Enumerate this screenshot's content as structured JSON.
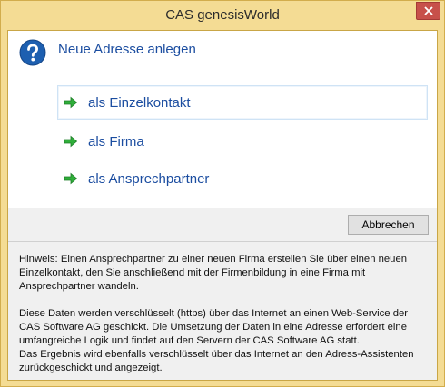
{
  "window": {
    "title": "CAS genesisWorld",
    "close_icon": "close-icon"
  },
  "dialog": {
    "heading": "Neue Adresse anlegen",
    "heading_icon": "question-icon",
    "options": [
      {
        "label": "als Einzelkontakt",
        "icon": "green-arrow-icon",
        "selected": true
      },
      {
        "label": "als Firma",
        "icon": "green-arrow-icon",
        "selected": false
      },
      {
        "label": "als Ansprechpartner",
        "icon": "green-arrow-icon",
        "selected": false
      }
    ],
    "cancel_label": "Abbrechen"
  },
  "info": {
    "paragraph1": "Hinweis: Einen Ansprechpartner zu einer neuen Firma erstellen Sie über einen neuen Einzelkontakt, den Sie anschließend mit der Firmenbildung in eine Firma mit Ansprechpartner wandeln.",
    "paragraph2_line1": "Diese Daten werden verschlüsselt (https) über das Internet an einen Web-Service der CAS Software AG geschickt. Die Umsetzung der Daten in eine Adresse erfordert eine umfangreiche Logik und findet auf den Servern der CAS Software AG statt.",
    "paragraph2_line2": "Das Ergebnis wird ebenfalls verschlüsselt über das Internet an den Adress-Assistenten zurückgeschickt und angezeigt."
  },
  "colors": {
    "frame": "#f4dc94",
    "link_blue": "#1b4da0",
    "close_red": "#c7504a",
    "arrow_green": "#2fae3a"
  }
}
